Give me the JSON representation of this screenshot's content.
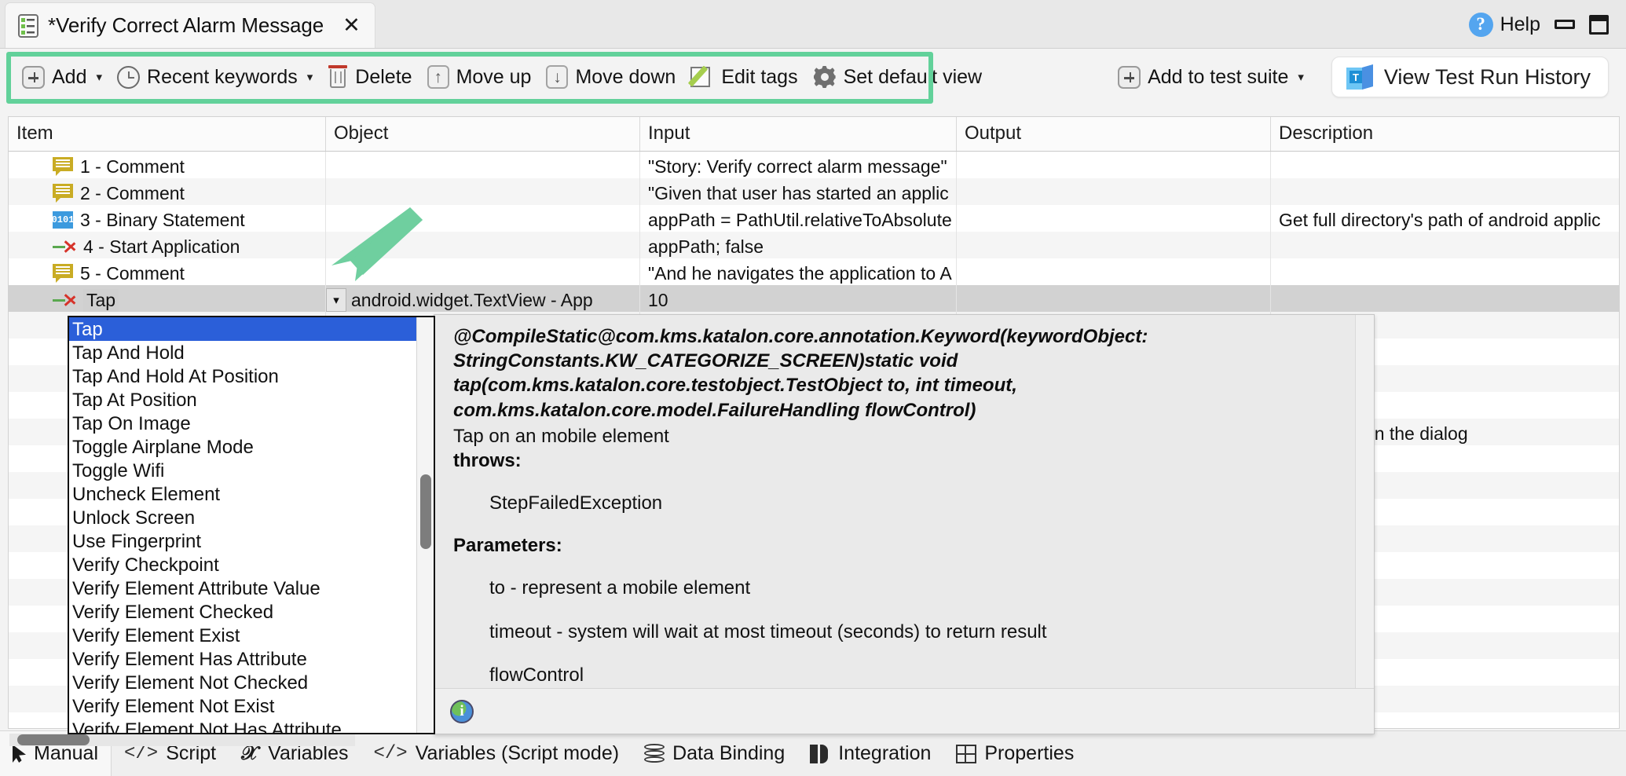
{
  "window": {
    "tab_title": "*Verify Correct Alarm Message",
    "tab_icon": "test-case-icon",
    "close_label": "✕",
    "help_label": "Help",
    "help_icon": "question-mark-icon",
    "minimize_icon": "minimize-icon",
    "maximize_icon": "maximize-icon"
  },
  "toolbar": {
    "highlight_color": "#62d19a",
    "items": [
      {
        "label": "Add",
        "icon": "plus-icon",
        "caret": "▾"
      },
      {
        "label": "Recent keywords",
        "icon": "clock-icon",
        "caret": "▾"
      },
      {
        "label": "Delete",
        "icon": "trash-icon",
        "caret": ""
      },
      {
        "label": "Move up",
        "icon": "arrow-up-icon",
        "caret": ""
      },
      {
        "label": "Move down",
        "icon": "arrow-down-icon",
        "caret": ""
      },
      {
        "label": "Edit tags",
        "icon": "edit-tags-icon",
        "caret": ""
      },
      {
        "label": "Set default view",
        "icon": "gear-icon",
        "caret": ""
      }
    ],
    "add_to_test_suite": {
      "label": "Add to test suite",
      "icon": "plus-icon",
      "caret": "▾"
    },
    "view_test_run_history": {
      "label": "View Test Run History",
      "icon": "katalon-icon"
    }
  },
  "table": {
    "columns": [
      "Item",
      "Object",
      "Input",
      "Output",
      "Description"
    ],
    "rows": [
      {
        "icon": "comment-icon",
        "item": "1 - Comment",
        "object": "",
        "input": "\"Story: Verify correct alarm message\"",
        "output": "",
        "description": ""
      },
      {
        "icon": "comment-icon",
        "item": "2 - Comment",
        "object": "",
        "input": "\"Given that user has started an applic",
        "output": "",
        "description": ""
      },
      {
        "icon": "binary-statement-icon",
        "item": "3 - Binary Statement",
        "object": "",
        "input": "appPath = PathUtil.relativeToAbsolute",
        "output": "",
        "description": "Get full directory's path of android applic"
      },
      {
        "icon": "start-application-icon",
        "item": "4 - Start Application",
        "object": "",
        "input": "appPath; false",
        "output": "",
        "description": ""
      },
      {
        "icon": "comment-icon",
        "item": "5 - Comment",
        "object": "",
        "input": "\"And he navigates the application to A",
        "output": "",
        "description": ""
      }
    ],
    "editing_row": {
      "icon": "tap-keyword-icon",
      "item": "Tap",
      "object": "android.widget.TextView - App",
      "object_dropdown_caret": "▾",
      "input": "10",
      "output": "",
      "description": ""
    },
    "background_description_row": "d message on the dialog"
  },
  "keyword_dropdown": {
    "selected": "Tap",
    "items": [
      "Tap",
      "Tap And Hold",
      "Tap And Hold At Position",
      "Tap At Position",
      "Tap On Image",
      "Toggle Airplane Mode",
      "Toggle Wifi",
      "Uncheck Element",
      "Unlock Screen",
      "Use Fingerprint",
      "Verify Checkpoint",
      "Verify Element Attribute Value",
      "Verify Element Checked",
      "Verify Element Exist",
      "Verify Element Has Attribute",
      "Verify Element Not Checked",
      "Verify Element Not Exist",
      "Verify Element Not Has Attribute"
    ]
  },
  "tooltip": {
    "signature": "@CompileStatic@com.kms.katalon.core.annotation.Keyword(keywordObject:\nStringConstants.KW_CATEGORIZE_SCREEN)static void\ntap(com.kms.katalon.core.testobject.TestObject to, int timeout,\ncom.kms.katalon.core.model.FailureHandling flowControl)",
    "description": "Tap on an mobile element",
    "throws_label": "throws:",
    "throws_value": "StepFailedException",
    "parameters_label": "Parameters:",
    "parameters": [
      "to - represent a mobile element",
      "timeout - system will wait at most timeout (seconds) to return result",
      "flowControl"
    ],
    "footer_icon": "info-globe-icon"
  },
  "bottom_tabs": [
    {
      "label": "Manual",
      "icon": "cursor-icon",
      "active": true
    },
    {
      "label": "Script",
      "icon": "code-icon",
      "active": false
    },
    {
      "label": "Variables",
      "icon": "variable-icon",
      "active": false
    },
    {
      "label": "Variables (Script mode)",
      "icon": "code-icon",
      "active": false
    },
    {
      "label": "Data Binding",
      "icon": "database-icon",
      "active": false
    },
    {
      "label": "Integration",
      "icon": "integration-icon",
      "active": false
    },
    {
      "label": "Properties",
      "icon": "grid-icon",
      "active": false
    }
  ]
}
